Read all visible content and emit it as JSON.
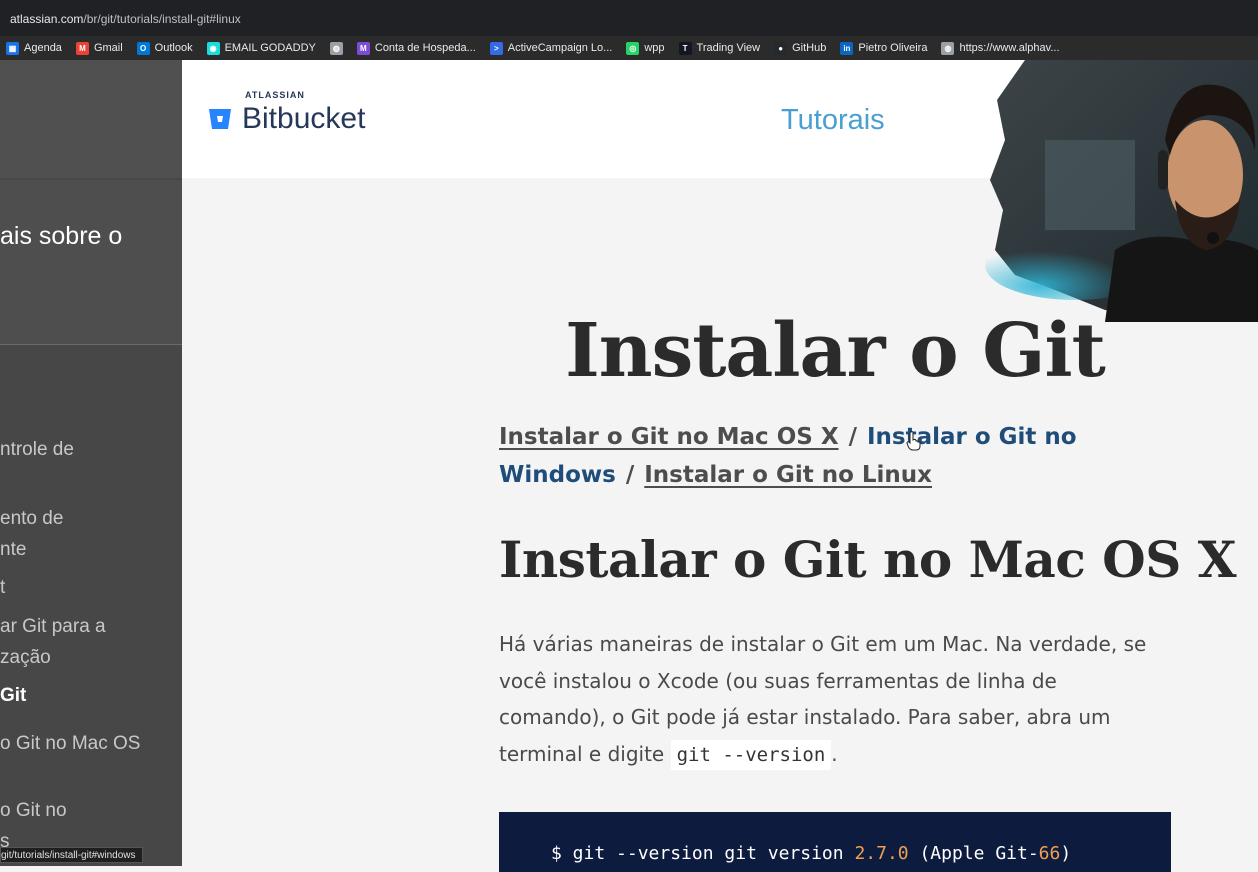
{
  "browser": {
    "url_host": "atlassian.com",
    "url_path": "/br/git/tutorials/install-git#linux",
    "bookmarks": [
      {
        "label": "Agenda",
        "icon": "calendar-icon",
        "color": "#1a73e8"
      },
      {
        "label": "Gmail",
        "icon": "gmail-icon",
        "color": "#ea4335"
      },
      {
        "label": "Outlook",
        "icon": "outlook-icon",
        "color": "#0078d4"
      },
      {
        "label": "EMAIL GODADDY",
        "icon": "godaddy-icon",
        "color": "#1bdbdb"
      },
      {
        "label": "",
        "icon": "globe-icon",
        "color": "#9aa0a6"
      },
      {
        "label": "Conta de Hospeda...",
        "icon": "hosting-icon",
        "color": "#7b4dd6"
      },
      {
        "label": "ActiveCampaign Lo...",
        "icon": "activecampaign-icon",
        "color": "#356ae6"
      },
      {
        "label": "wpp",
        "icon": "whatsapp-icon",
        "color": "#25d366"
      },
      {
        "label": "Trading View",
        "icon": "tradingview-icon",
        "color": "#131722"
      },
      {
        "label": "GitHub",
        "icon": "github-icon",
        "color": "#24292e"
      },
      {
        "label": "Pietro Oliveira",
        "icon": "linkedin-icon",
        "color": "#0a66c2"
      },
      {
        "label": "https://www.alphav...",
        "icon": "globe-icon",
        "color": "#9aa0a6"
      }
    ],
    "status_url": "git/tutorials/install-git#windows"
  },
  "sidebar": {
    "section_title": "ais sobre o",
    "items": [
      {
        "label": "ntrole de"
      },
      {
        "label": "ento de"
      },
      {
        "label": "nte"
      },
      {
        "label": "t"
      },
      {
        "label": "ar Git para a"
      },
      {
        "label": "zação"
      },
      {
        "label": "Git"
      },
      {
        "label": "o Git no Mac OS"
      },
      {
        "label": "o Git no"
      },
      {
        "label": "s"
      }
    ]
  },
  "header": {
    "brand_small": "ATLASSIAN",
    "brand": "Bitbucket",
    "nav_tutorials": "Tutorais"
  },
  "page": {
    "title": "Instalar o Git",
    "links": [
      {
        "label": "Instalar o Git no Mac OS X"
      },
      {
        "label": "Instalar o Git no Windows"
      },
      {
        "label": "Instalar o Git no Linux"
      }
    ],
    "separator": "/",
    "section_heading": "Instalar o Git no Mac OS X",
    "paragraph_text": "Há várias maneiras de instalar o Git em um Mac. Na verdade, se você instalou o Xcode (ou suas ferramentas de linha de comando), o Git pode já estar instalado. Para saber, abra um terminal e digite",
    "inline_code": "git --version",
    "paragraph_end": ".",
    "code": {
      "prompt_part": "$ git --version git version ",
      "version": "2.7.0",
      "paren_open": " (Apple Git-",
      "build": "66",
      "paren_close": ")"
    }
  },
  "colors": {
    "link_blue": "#1f4d7a",
    "nav_blue": "#4a9fd1",
    "code_bg": "#0d1b3e",
    "code_number": "#f0a050"
  }
}
